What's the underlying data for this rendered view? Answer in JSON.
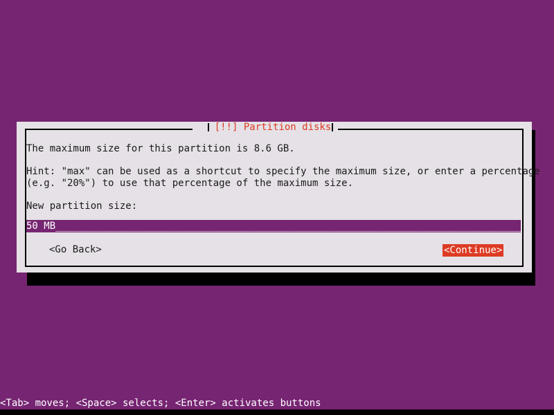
{
  "screen": {
    "background_color": "#762572",
    "accent_color": "#dd3b24",
    "panel_color": "#e5e1e6",
    "text_color": "#1a1a1a"
  },
  "dialog": {
    "title": "[!!] Partition disks",
    "lines": {
      "max_size": "The maximum size for this partition is 8.6 GB.",
      "hint_line1": "Hint: \"max\" can be used as a shortcut to specify the maximum size, or enter a percentage",
      "hint_line2": "(e.g. \"20%\") to use that percentage of the maximum size.",
      "field_label": "New partition size:"
    },
    "input": {
      "value": "50 MB",
      "fill": "_________________________________________________________________________________________"
    },
    "buttons": {
      "go_back": "<Go Back>",
      "continue": "<Continue>"
    }
  },
  "status": {
    "help_text": "<Tab> moves; <Space> selects; <Enter> activates buttons"
  }
}
